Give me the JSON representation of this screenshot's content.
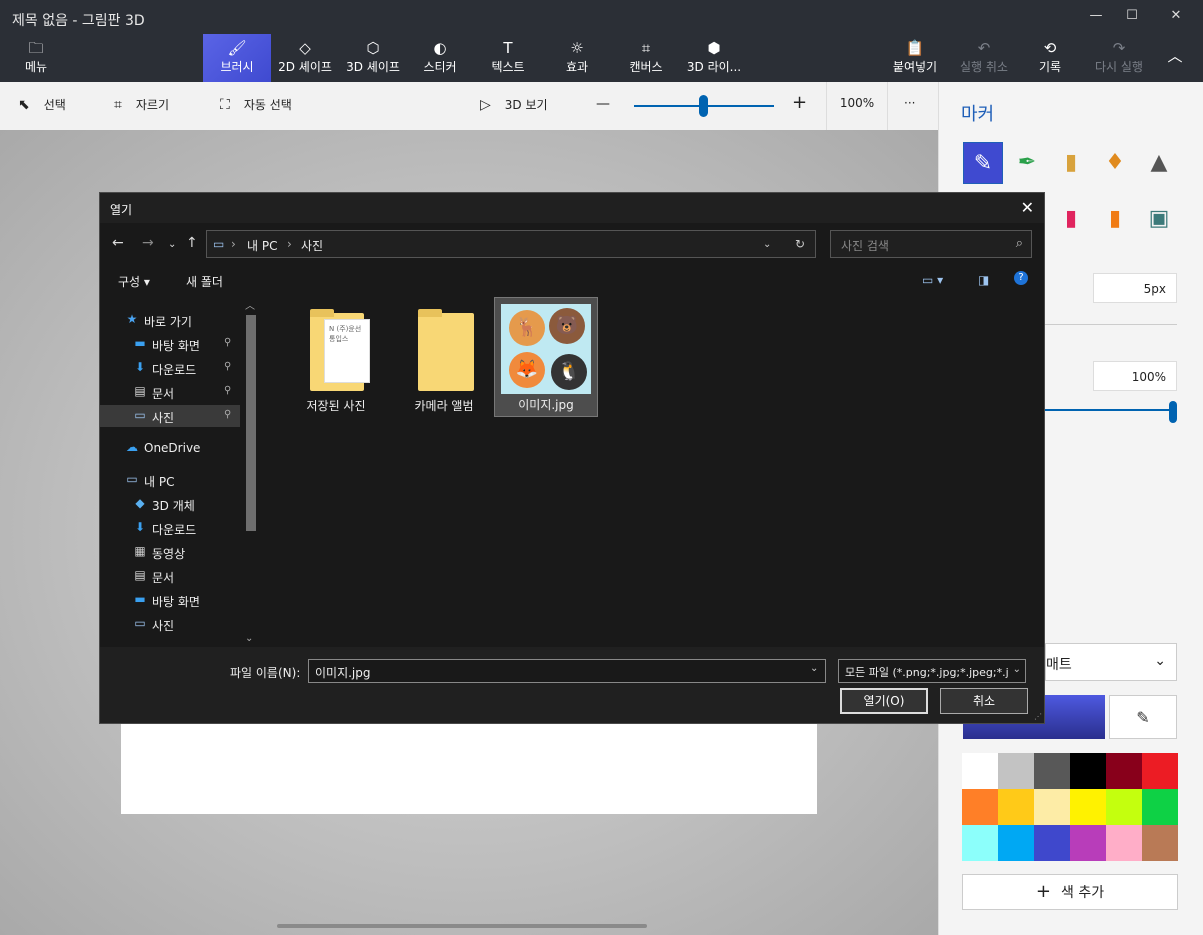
{
  "app": {
    "title": "제목 없음 - 그림판 3D",
    "window_controls": {
      "minimize": "—",
      "maximize": "☐",
      "close": "✕"
    }
  },
  "ribbon": {
    "menu": {
      "label": "메뉴",
      "icon": "folder-icon"
    },
    "tools": [
      {
        "label": "브러시",
        "icon": "brush-icon",
        "active": true
      },
      {
        "label": "2D 셰이프",
        "icon": "2d-shapes-icon"
      },
      {
        "label": "3D 셰이프",
        "icon": "3d-shapes-icon"
      },
      {
        "label": "스티커",
        "icon": "sticker-icon"
      },
      {
        "label": "텍스트",
        "icon": "text-icon"
      },
      {
        "label": "효과",
        "icon": "effects-icon"
      },
      {
        "label": "캔버스",
        "icon": "canvas-icon"
      },
      {
        "label": "3D 라이...",
        "icon": "3d-library-icon"
      }
    ],
    "right_actions": [
      {
        "label": "붙여넣기",
        "icon": "paste-icon",
        "enabled": true
      },
      {
        "label": "실행 취소",
        "icon": "undo-icon",
        "enabled": false
      },
      {
        "label": "기록",
        "icon": "history-icon",
        "enabled": true
      },
      {
        "label": "다시 실행",
        "icon": "redo-icon",
        "enabled": false
      }
    ],
    "collapse_icon": "chevron-up-icon"
  },
  "toolbar": {
    "select": "선택",
    "crop": "자르기",
    "magic_select": "자동 선택",
    "view3d": "3D 보기",
    "zoom_minus": "—",
    "zoom_plus": "+",
    "zoom_level": "100%",
    "zoom_fraction": 0.46,
    "more": "···"
  },
  "side_panel": {
    "title": "마커",
    "brushes_row1": [
      "marker-icon",
      "calligraphy-pen-icon",
      "oil-brush-icon",
      "watercolor-icon",
      "pixel-pen-icon"
    ],
    "brushes_row2": [
      "crayon-icon",
      "spray-can-icon",
      "fill-bucket-icon"
    ],
    "thickness": "5px",
    "opacity": "100%",
    "finish_label": "매트",
    "current_color": "#3f4ad0",
    "palette": [
      "#ffffff",
      "#c3c3c3",
      "#585858",
      "#000000",
      "#88001b",
      "#ec1c24",
      "#ff7f27",
      "#ffca18",
      "#fdeca6",
      "#fff200",
      "#c4ff0e",
      "#0ed145",
      "#8cfffb",
      "#00a8f3",
      "#3f48cc",
      "#b83dba",
      "#ffaec8",
      "#b97a56"
    ],
    "add_color": "색 추가"
  },
  "dialog": {
    "title": "열기",
    "close": "✕",
    "path": [
      "내 PC",
      "사진"
    ],
    "search_placeholder": "사진 검색",
    "organize": "구성 ▾",
    "new_folder": "새 폴더",
    "nav_items": [
      {
        "label": "바로 가기",
        "icon": "star-icon",
        "indent": 1
      },
      {
        "label": "바탕 화면",
        "icon": "desktop-icon",
        "indent": 2,
        "pinned": true
      },
      {
        "label": "다운로드",
        "icon": "download-icon",
        "indent": 2,
        "pinned": true
      },
      {
        "label": "문서",
        "icon": "document-icon",
        "indent": 2,
        "pinned": true
      },
      {
        "label": "사진",
        "icon": "pictures-icon",
        "indent": 2,
        "pinned": true,
        "selected": true
      },
      {
        "label": "OneDrive",
        "icon": "cloud-icon",
        "indent": 1
      },
      {
        "label": "내 PC",
        "icon": "computer-icon",
        "indent": 1
      },
      {
        "label": "3D 개체",
        "icon": "3d-objects-icon",
        "indent": 2
      },
      {
        "label": "다운로드",
        "icon": "download-icon",
        "indent": 2
      },
      {
        "label": "동영상",
        "icon": "video-icon",
        "indent": 2
      },
      {
        "label": "문서",
        "icon": "document-icon",
        "indent": 2
      },
      {
        "label": "바탕 화면",
        "icon": "desktop-icon",
        "indent": 2
      },
      {
        "label": "사진",
        "icon": "pictures-icon",
        "indent": 2
      }
    ],
    "files": [
      {
        "label": "저장된 사진",
        "type": "folder-with-paper",
        "paper_text": "N (주)윤선통입스"
      },
      {
        "label": "카메라 앨범",
        "type": "folder"
      },
      {
        "label": "이미지.jpg",
        "type": "image",
        "selected": true
      }
    ],
    "filename_label": "파일 이름(N):",
    "filename_value": "이미지.jpg",
    "filetype_value": "모든 파일 (*.png;*.jpg;*.jpeg;*.j",
    "open_button": "열기(O)",
    "cancel_button": "취소"
  }
}
